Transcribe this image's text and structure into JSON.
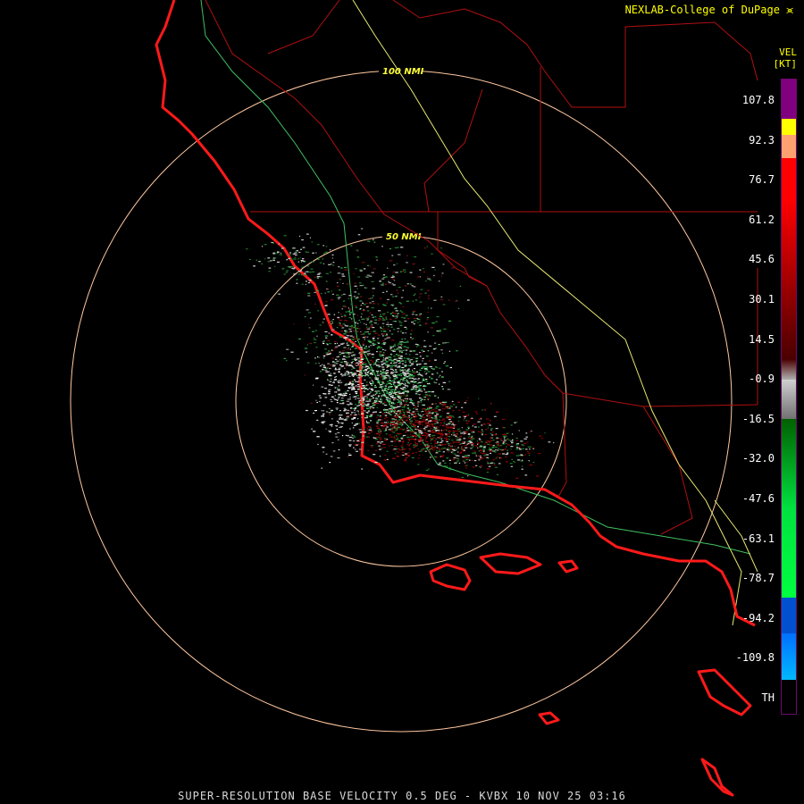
{
  "header": {
    "credit": "NEXLAB-College of DuPage"
  },
  "legend": {
    "title": "VEL",
    "unit": "[KT]",
    "ticks": [
      "107.8",
      "92.3",
      "76.7",
      "61.2",
      "45.6",
      "30.1",
      "14.5",
      "-0.9",
      "-16.5",
      "-32.0",
      "-47.6",
      "-63.1",
      "-78.7",
      "-94.2",
      "-109.8",
      "TH"
    ],
    "colors": [
      "#80007f",
      "#ffff00",
      "#ffa070",
      "#ff0000",
      "#c00000",
      "#800000",
      "#b0b0b0",
      "#008000",
      "#00ff40",
      "#0070ff",
      "#00b8ff",
      "#2a002a"
    ]
  },
  "map": {
    "rings": [
      {
        "label": "100 NMI"
      },
      {
        "label": "50 NMI"
      }
    ],
    "colors": {
      "coast": "#ff1a1a",
      "county": "#b01010",
      "ring": "#ffc8a0",
      "highway_yellow": "#e8e870",
      "highway_green": "#40c060"
    }
  },
  "caption": "SUPER-RESOLUTION BASE VELOCITY 0.5 DEG - KVBX 10 NOV 25 03:16"
}
